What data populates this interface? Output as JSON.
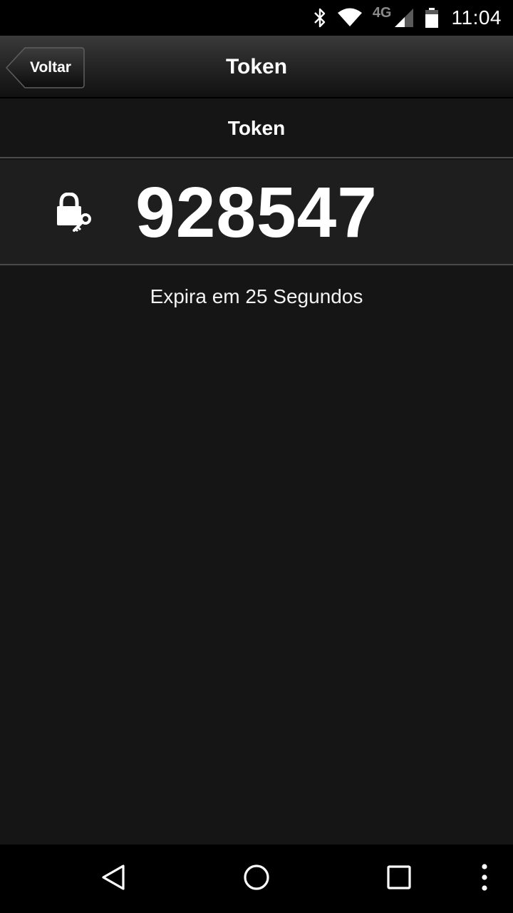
{
  "status_bar": {
    "network_label": "4G",
    "time": "11:04",
    "icons": [
      "bluetooth-icon",
      "wifi-icon",
      "cell-signal-icon",
      "battery-icon"
    ]
  },
  "action_bar": {
    "back_label": "Voltar",
    "title": "Token"
  },
  "section": {
    "header": "Token"
  },
  "token": {
    "icon": "lock-key-icon",
    "value": "928547",
    "expiry_text": "Expira em 25 Segundos"
  },
  "nav_bar": {
    "icons": [
      "back-triangle-icon",
      "home-circle-icon",
      "recents-square-icon",
      "overflow-menu-icon"
    ]
  },
  "colors": {
    "background": "#151515",
    "token_row_bg": "#1e1e1e",
    "divider": "#4a4a4a",
    "text": "#ffffff"
  }
}
